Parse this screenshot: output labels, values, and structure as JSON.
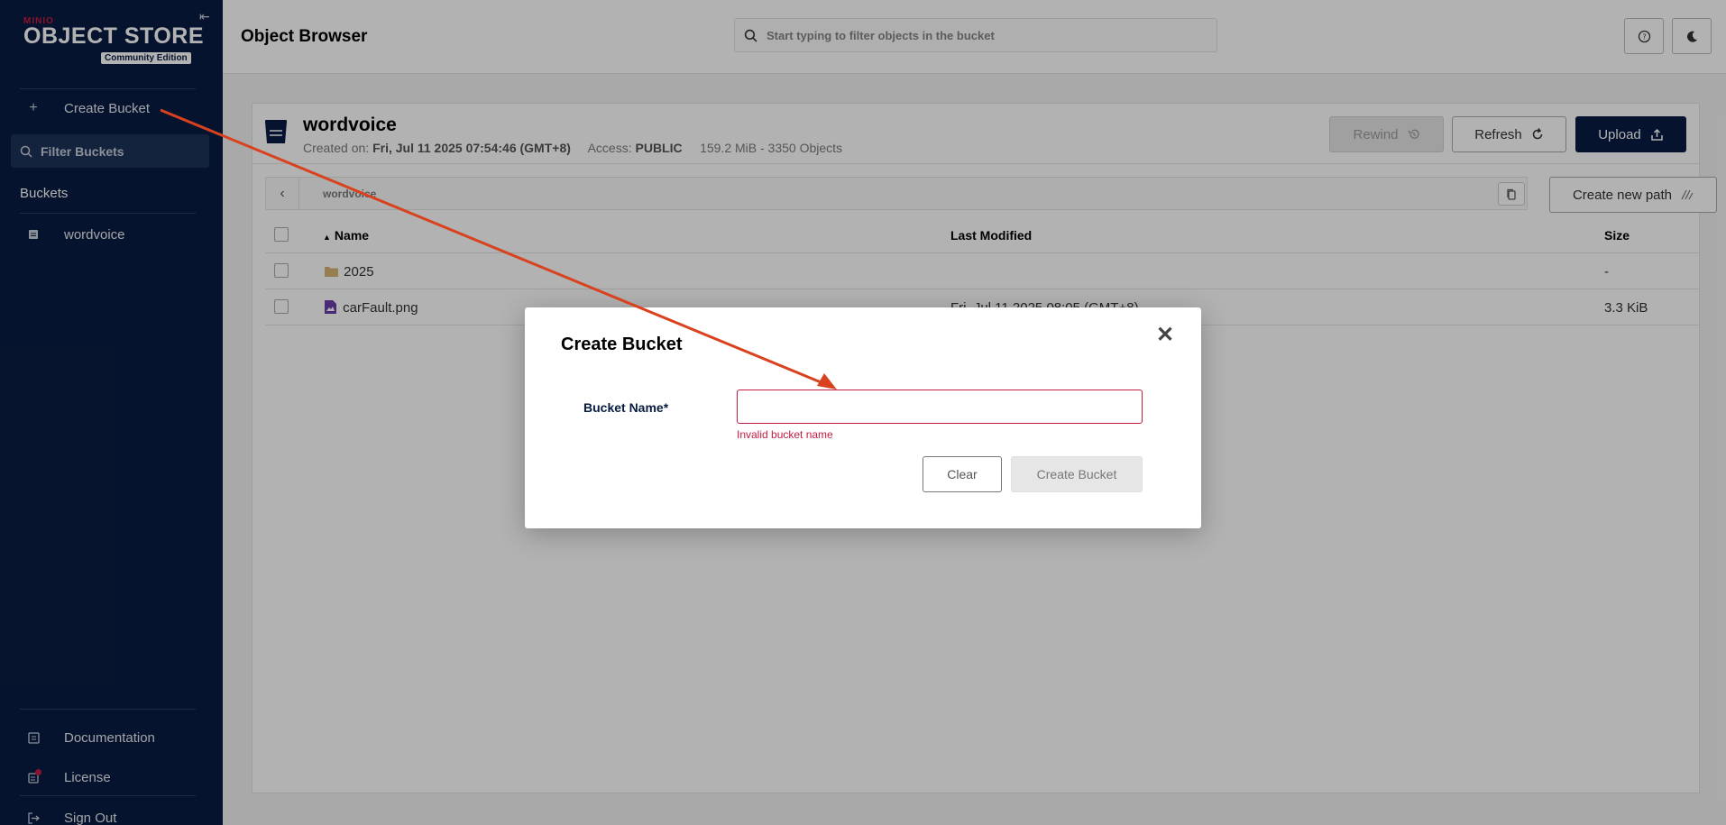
{
  "sidebar": {
    "logo_brand": "MINIO",
    "logo_product": "OBJECT STORE",
    "logo_edition": "Community Edition",
    "create_bucket_label": "Create Bucket",
    "filter_placeholder": "Filter Buckets",
    "buckets_heading": "Buckets",
    "buckets": [
      {
        "label": "wordvoice"
      }
    ],
    "documentation_label": "Documentation",
    "license_label": "License",
    "signout_label": "Sign Out"
  },
  "header": {
    "title": "Object Browser",
    "search_placeholder": "Start typing to filter objects in the bucket"
  },
  "bucket": {
    "name": "wordvoice",
    "created_label": "Created on:",
    "created_value": "Fri, Jul 11 2025 07:54:46 (GMT+8)",
    "access_label": "Access:",
    "access_value": "PUBLIC",
    "usage": "159.2 MiB - 3350 Objects",
    "rewind_label": "Rewind",
    "refresh_label": "Refresh",
    "upload_label": "Upload",
    "path": "wordvoice",
    "new_path_label": "Create new path"
  },
  "table": {
    "headers": {
      "name": "Name",
      "modified": "Last Modified",
      "size": "Size"
    },
    "rows": [
      {
        "name": "2025",
        "modified": "",
        "size": "-"
      },
      {
        "name": "carFault.png",
        "modified": "Fri, Jul 11 2025 08:05 (GMT+8)",
        "size": "3.3 KiB"
      }
    ]
  },
  "modal": {
    "title": "Create Bucket",
    "field_label": "Bucket Name*",
    "field_value": "",
    "error": "Invalid bucket name",
    "clear_label": "Clear",
    "create_label": "Create Bucket"
  },
  "colors": {
    "sidebar_bg": "#081c42",
    "accent_red": "#c51b3f",
    "annotation_arrow": "#d9421e"
  }
}
